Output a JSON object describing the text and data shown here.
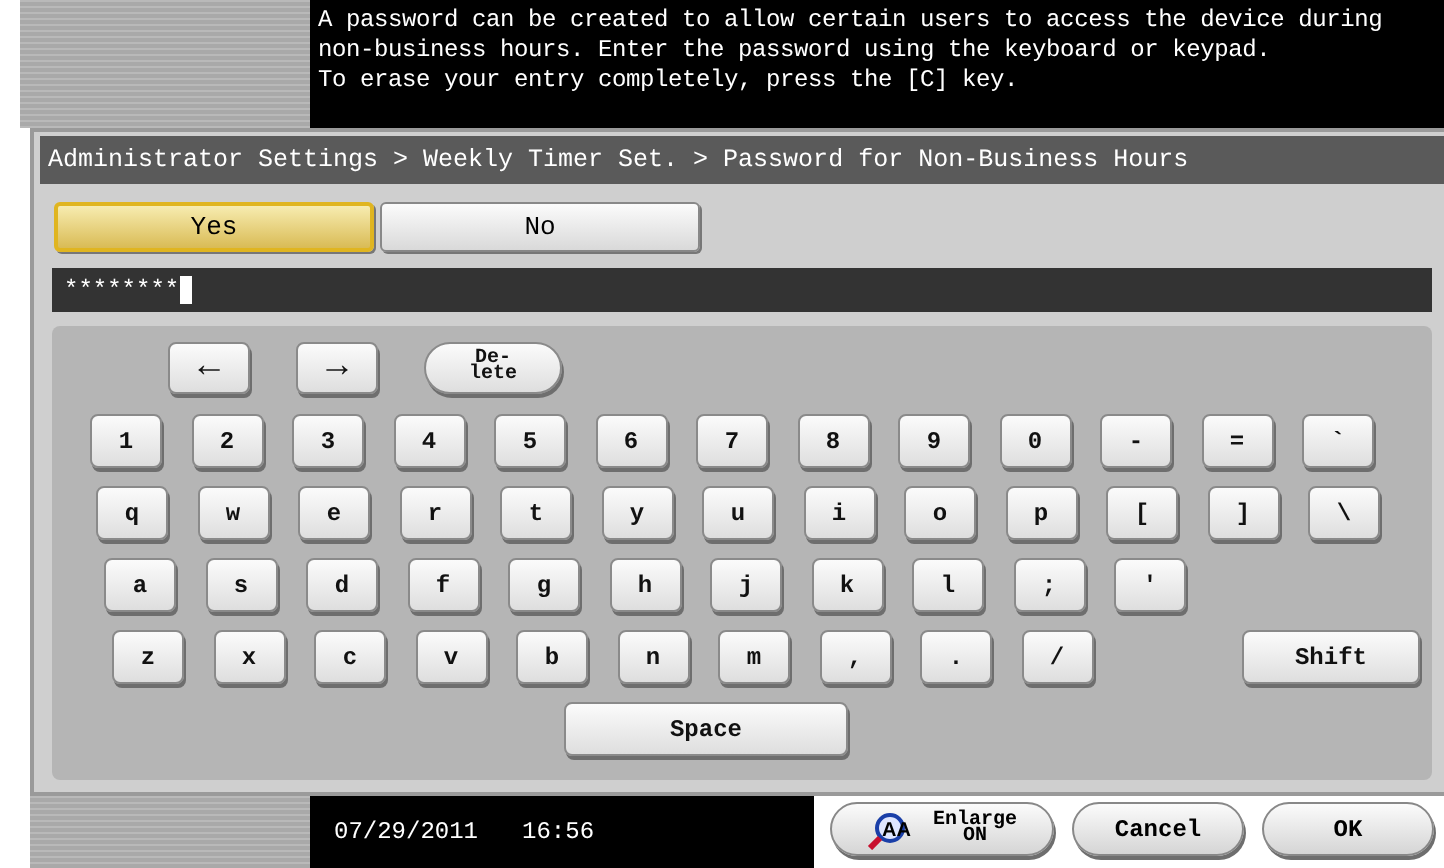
{
  "message": "A password can be created to allow certain users to access the device during\nnon-business hours. Enter the password using the keyboard or keypad.\nTo erase your entry completely, press the [C] key.",
  "breadcrumb": "Administrator Settings > Weekly Timer Set. > Password for Non-Business Hours",
  "choices": [
    {
      "label": "Yes",
      "selected": true
    },
    {
      "label": "No",
      "selected": false
    }
  ],
  "password_field": {
    "value": "********"
  },
  "edit_keys": [
    {
      "kind": "left",
      "label": "←"
    },
    {
      "kind": "right",
      "label": "→"
    },
    {
      "kind": "delete",
      "label": "De-\nlete"
    }
  ],
  "keyboard_rows": [
    [
      "1",
      "2",
      "3",
      "4",
      "5",
      "6",
      "7",
      "8",
      "9",
      "0",
      "-",
      "=",
      "`"
    ],
    [
      "q",
      "w",
      "e",
      "r",
      "t",
      "y",
      "u",
      "i",
      "o",
      "p",
      "[",
      "]",
      "\\"
    ],
    [
      "a",
      "s",
      "d",
      "f",
      "g",
      "h",
      "j",
      "k",
      "l",
      ";",
      "'"
    ],
    [
      "z",
      "x",
      "c",
      "v",
      "b",
      "n",
      "m",
      ",",
      ".",
      "/"
    ]
  ],
  "shift_key": "Shift",
  "space_key": "Space",
  "status_bar": {
    "date": "07/29/2011",
    "time": "16:56"
  },
  "enlarge": {
    "icon_letters": "AA",
    "label": "Enlarge",
    "state": "ON"
  },
  "buttons": [
    "Cancel",
    "OK"
  ]
}
